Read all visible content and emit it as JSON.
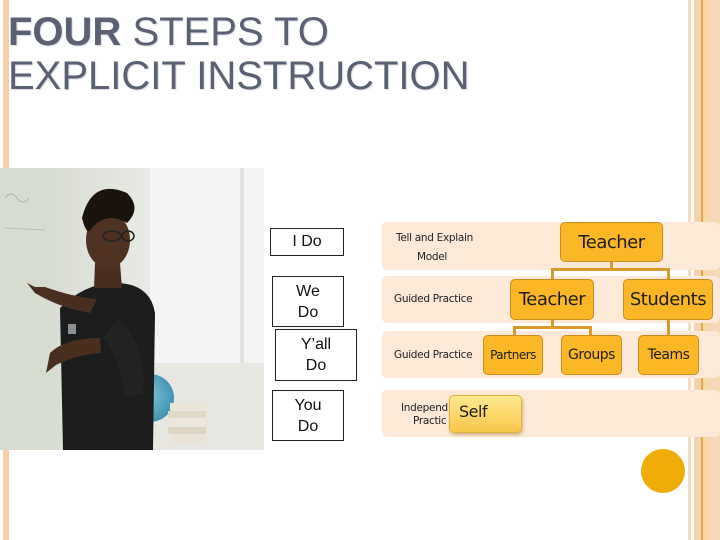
{
  "slide": {
    "title_bold": "FOUR",
    "title_rest_line1": " STEPS TO",
    "title_line2": "EXPLICIT INSTRUCTION"
  },
  "photo": {
    "description": "Teacher pointing at whiteboard"
  },
  "steps": [
    {
      "line1": "I Do",
      "line2": ""
    },
    {
      "line1": "We",
      "line2": "Do"
    },
    {
      "line1": "Y’all",
      "line2": "Do"
    },
    {
      "line1": "You",
      "line2": "Do"
    }
  ],
  "diagram": {
    "rows": [
      {
        "label_line1": "Tell and Explain",
        "label_line2": "Model"
      },
      {
        "label_line1": "Guided Practice",
        "label_line2": ""
      },
      {
        "label_line1": "Guided Practice",
        "label_line2": ""
      },
      {
        "label_line1": "Independ",
        "label_line2": "Practic"
      }
    ],
    "nodes": {
      "root": "Teacher",
      "level2_left": "Teacher",
      "level2_right": "Students",
      "partners": "Partners",
      "groups": "Groups",
      "teams": "Teams",
      "self": "Self"
    },
    "colors": {
      "node_fill": "#fbb726",
      "band_fill": "#fde9d8",
      "accent_circle": "#efac06",
      "border_peach": "#f5cfa8"
    }
  }
}
